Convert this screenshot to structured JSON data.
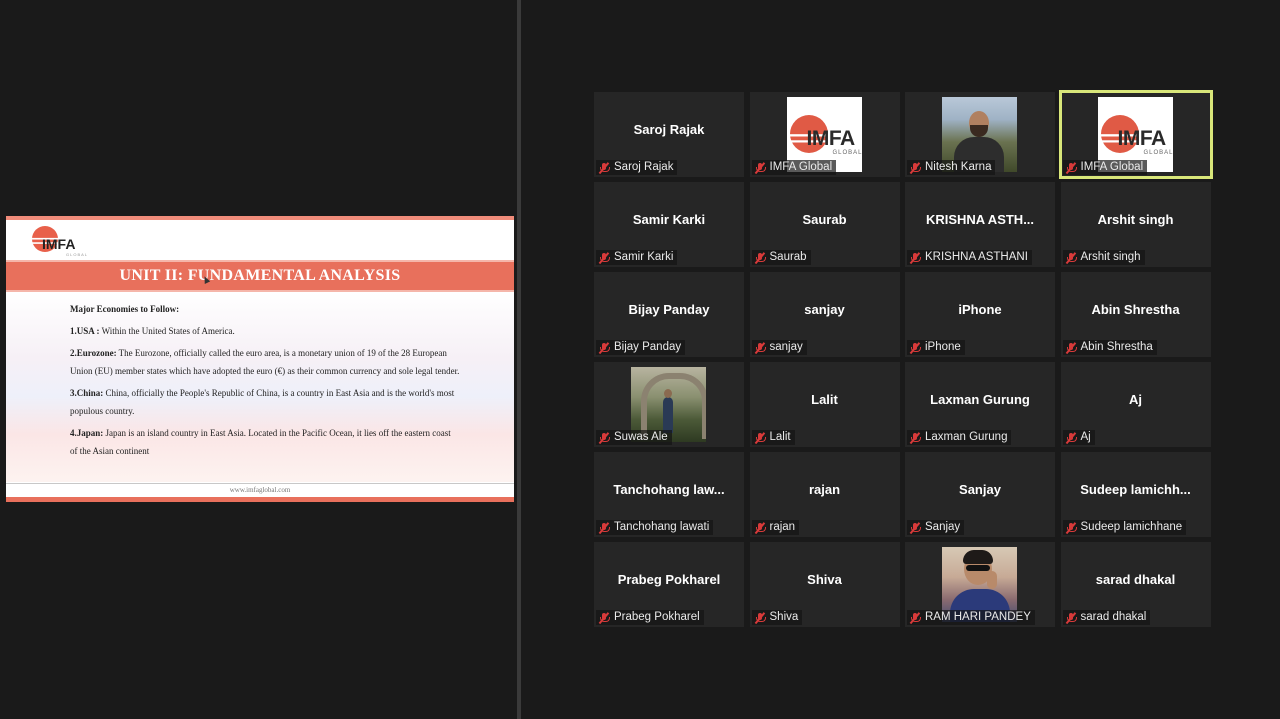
{
  "slide": {
    "logo_text": "IMFA",
    "logo_sub": "GLOBAL",
    "title": "UNIT II: FUNDAMENTAL ANALYSIS",
    "heading": "Major Economies to Follow:",
    "points": [
      {
        "label": "1.USA :",
        "text": " Within the United States of America."
      },
      {
        "label": "2.Eurozone:",
        "text": " The Eurozone, officially called the euro area, is a monetary union of 19 of the 28 European Union (EU) member states which have adopted the euro (€) as their common currency and sole legal tender."
      },
      {
        "label": "3.China:",
        "text": " China, officially the People's Republic of China, is a country in East Asia and is the world's most populous country."
      },
      {
        "label": "4.Japan:",
        "text": " Japan is an island country in East Asia. Located in the Pacific Ocean, it lies off the eastern coast of the Asian continent"
      }
    ],
    "footer": "www.imfaglobal.com"
  },
  "participants": [
    {
      "display": "Saroj Rajak",
      "label": "Saroj Rajak",
      "avatar": "text"
    },
    {
      "display": "",
      "label": "IMFA Global",
      "avatar": "imfa-logo"
    },
    {
      "display": "",
      "label": "Nitesh Karna",
      "avatar": "photo-nitesh"
    },
    {
      "display": "",
      "label": "IMFA Global",
      "avatar": "imfa-logo",
      "active": true
    },
    {
      "display": "Samir Karki",
      "label": "Samir Karki",
      "avatar": "text"
    },
    {
      "display": "Saurab",
      "label": "Saurab",
      "avatar": "text"
    },
    {
      "display": "KRISHNA ASTH...",
      "label": "KRISHNA ASTHANI",
      "avatar": "text"
    },
    {
      "display": "Arshit singh",
      "label": "Arshit singh",
      "avatar": "text"
    },
    {
      "display": "Bijay Panday",
      "label": "Bijay Panday",
      "avatar": "text"
    },
    {
      "display": "sanjay",
      "label": "sanjay",
      "avatar": "text"
    },
    {
      "display": "iPhone",
      "label": "iPhone",
      "avatar": "text"
    },
    {
      "display": "Abin Shrestha",
      "label": "Abin Shrestha",
      "avatar": "text"
    },
    {
      "display": "",
      "label": "Suwas Ale",
      "avatar": "photo-suwas"
    },
    {
      "display": "Lalit",
      "label": "Lalit",
      "avatar": "text"
    },
    {
      "display": "Laxman Gurung",
      "label": "Laxman Gurung",
      "avatar": "text"
    },
    {
      "display": "Aj",
      "label": "Aj",
      "avatar": "text"
    },
    {
      "display": "Tanchohang law...",
      "label": "Tanchohang lawati",
      "avatar": "text"
    },
    {
      "display": "rajan",
      "label": "rajan",
      "avatar": "text"
    },
    {
      "display": "Sanjay",
      "label": "Sanjay",
      "avatar": "text"
    },
    {
      "display": "Sudeep lamichh...",
      "label": "Sudeep lamichhane",
      "avatar": "text"
    },
    {
      "display": "Prabeg Pokharel",
      "label": "Prabeg Pokharel",
      "avatar": "text"
    },
    {
      "display": "Shiva",
      "label": "Shiva",
      "avatar": "text"
    },
    {
      "display": "",
      "label": "RAM HARI PANDEY",
      "avatar": "photo-ram"
    },
    {
      "display": "sarad dhakal",
      "label": "sarad dhakal",
      "avatar": "text"
    }
  ],
  "colors": {
    "accent_active": "#d9e77a",
    "muted_mic": "#d83a3a",
    "slide_title_bar": "#e8705c"
  },
  "icons": {
    "mic": "mic-muted-icon"
  }
}
